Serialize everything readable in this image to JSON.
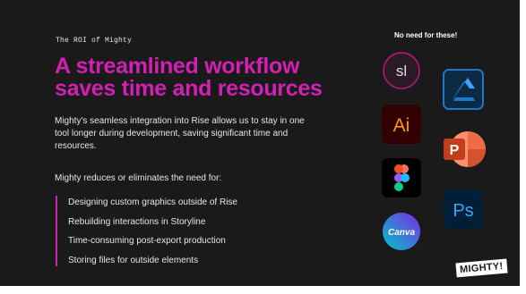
{
  "slide": {
    "eyebrow": "The ROI of Mighty",
    "headline": "A streamlined workflow saves time and resources",
    "intro": "Mighty's seamless integration into Rise allows us to stay in one tool longer during development, saving significant time and resources.",
    "lead": "Mighty reduces or eliminates the need for:",
    "bullets": [
      "Designing custom graphics outside of Rise",
      "Rebuilding interactions in Storyline",
      "Time-consuming post-export production",
      "Storing files for outside elements"
    ],
    "tagline": "No need for these!",
    "logo_text": "MIGHTY!",
    "colors": {
      "accent": "#d21fb4",
      "background": "#1a1a1a"
    },
    "icons": {
      "storyline": "sl",
      "illustrator": "Ai",
      "photoshop": "Ps",
      "powerpoint": "P",
      "canva": "Canva",
      "affinity": "affinity-designer-icon",
      "figma": "figma-icon"
    }
  }
}
